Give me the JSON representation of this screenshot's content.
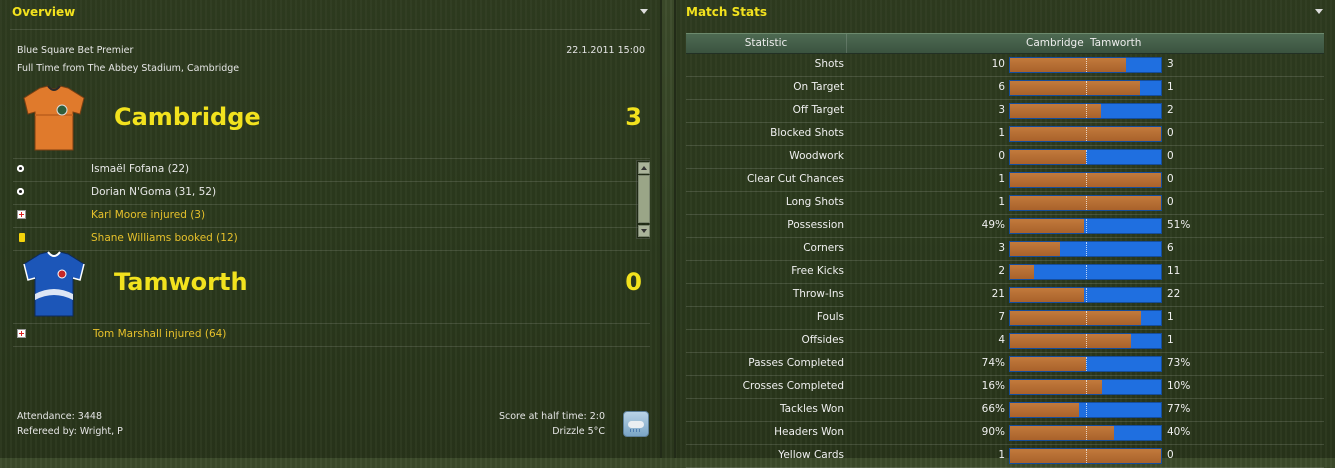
{
  "overview": {
    "title": "Overview",
    "competition": "Blue Square Bet Premier",
    "datetime": "22.1.2011 15:00",
    "venue_line": "Full Time from The Abbey Stadium, Cambridge",
    "home": {
      "name": "Cambridge",
      "score": "3",
      "shirt_colors": [
        "#e07a2c",
        "#2a2a2a"
      ],
      "events": [
        {
          "icon": "goal-ball-icon",
          "text": "Ismaël Fofana (22)",
          "highlight": false
        },
        {
          "icon": "goal-ball-icon",
          "text": "Dorian N'Goma (31, 52)",
          "highlight": false
        },
        {
          "icon": "injury-icon",
          "text": "Karl Moore injured (3)",
          "highlight": true
        },
        {
          "icon": "yellow-card-icon",
          "text": "Shane Williams booked (12)",
          "highlight": true
        }
      ]
    },
    "away": {
      "name": "Tamworth",
      "score": "0",
      "shirt_colors": [
        "#1c56b8",
        "#ffffff"
      ],
      "events": [
        {
          "icon": "injury-icon",
          "text": "Tom Marshall injured (64)",
          "highlight": true
        }
      ]
    },
    "attendance": "Attendance: 3448",
    "referee": "Refereed by: Wright, P",
    "halftime": "Score at half time: 2:0",
    "weather": "Drizzle 5°C",
    "weather_icon": "drizzle-icon"
  },
  "stats": {
    "title": "Match Stats",
    "col_stat": "Statistic",
    "col_home": "Cambridge",
    "col_away": "Tamworth",
    "home_color": "#b86d33",
    "away_color": "#1f70e0",
    "rows": [
      {
        "label": "Shots",
        "home": "10",
        "away": "3",
        "home_share": 0.77
      },
      {
        "label": "On Target",
        "home": "6",
        "away": "1",
        "home_share": 0.86
      },
      {
        "label": "Off Target",
        "home": "3",
        "away": "2",
        "home_share": 0.6
      },
      {
        "label": "Blocked Shots",
        "home": "1",
        "away": "0",
        "home_share": 1.0
      },
      {
        "label": "Woodwork",
        "home": "0",
        "away": "0",
        "home_share": 0.5
      },
      {
        "label": "Clear Cut Chances",
        "home": "1",
        "away": "0",
        "home_share": 1.0
      },
      {
        "label": "Long Shots",
        "home": "1",
        "away": "0",
        "home_share": 1.0
      },
      {
        "label": "Possession",
        "home": "49%",
        "away": "51%",
        "home_share": 0.49
      },
      {
        "label": "Corners",
        "home": "3",
        "away": "6",
        "home_share": 0.33
      },
      {
        "label": "Free Kicks",
        "home": "2",
        "away": "11",
        "home_share": 0.16
      },
      {
        "label": "Throw-Ins",
        "home": "21",
        "away": "22",
        "home_share": 0.49
      },
      {
        "label": "Fouls",
        "home": "7",
        "away": "1",
        "home_share": 0.87
      },
      {
        "label": "Offsides",
        "home": "4",
        "away": "1",
        "home_share": 0.8
      },
      {
        "label": "Passes Completed",
        "home": "74%",
        "away": "73%",
        "home_share": 0.5
      },
      {
        "label": "Crosses Completed",
        "home": "16%",
        "away": "10%",
        "home_share": 0.61
      },
      {
        "label": "Tackles Won",
        "home": "66%",
        "away": "77%",
        "home_share": 0.46
      },
      {
        "label": "Headers Won",
        "home": "90%",
        "away": "40%",
        "home_share": 0.69
      },
      {
        "label": "Yellow Cards",
        "home": "1",
        "away": "0",
        "home_share": 1.0
      }
    ]
  }
}
